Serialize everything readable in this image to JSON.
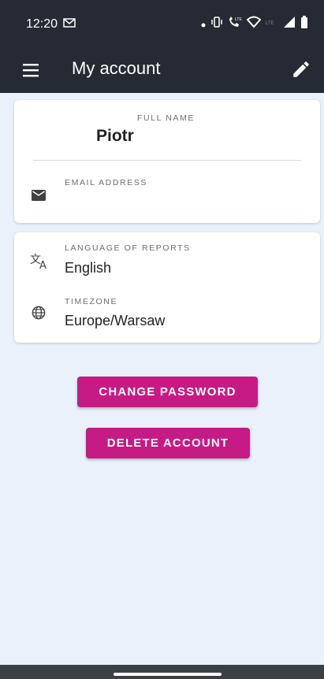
{
  "status_bar": {
    "time": "12:20",
    "icons": [
      "gmail-icon",
      "dot-icon",
      "vibrate-icon",
      "lte-call-icon",
      "wifi-icon",
      "lte-icon",
      "signal-icon",
      "battery-icon"
    ]
  },
  "app_bar": {
    "title": "My account",
    "menu_icon": "hamburger-menu-icon",
    "edit_icon": "pencil-icon"
  },
  "profile_card": {
    "full_name_label": "FULL NAME",
    "full_name_value": "Piotr",
    "email_label": "EMAIL ADDRESS",
    "email_value": "",
    "email_icon": "mail-icon"
  },
  "settings_card": {
    "language_label": "LANGUAGE OF REPORTS",
    "language_value": "English",
    "language_icon": "translate-icon",
    "timezone_label": "TIMEZONE",
    "timezone_value": "Europe/Warsaw",
    "timezone_icon": "globe-icon"
  },
  "actions": {
    "change_password": "CHANGE PASSWORD",
    "delete_account": "DELETE ACCOUNT"
  },
  "colors": {
    "app_bar": "#252a34",
    "accent": "#c61a84",
    "background": "#eaf1fb"
  }
}
